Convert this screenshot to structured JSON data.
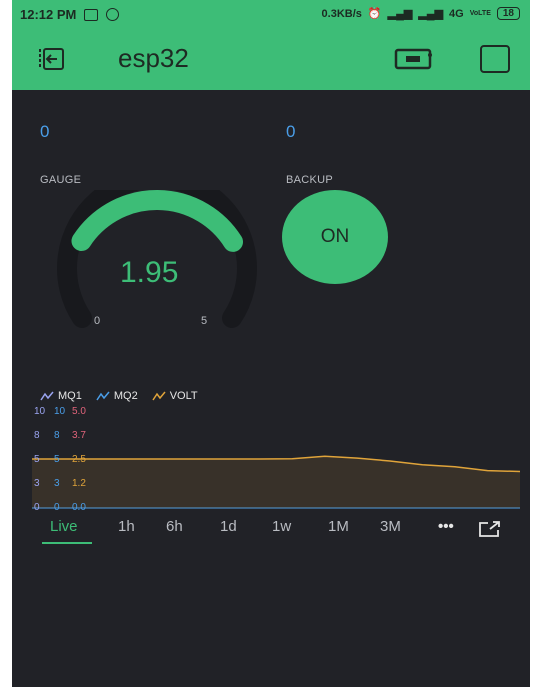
{
  "status_bar": {
    "time": "12:12 PM",
    "network_speed": "0.3KB/s",
    "network_type": "4G",
    "volte": "VoLTE",
    "battery": "18"
  },
  "app_bar": {
    "title": "esp32",
    "back_icon": "exit-icon",
    "device_icon": "device-icon",
    "menu_icon": "square-icon"
  },
  "widgets": {
    "left_value": "0",
    "right_value": "0",
    "gauge": {
      "label": "GAUGE",
      "value": "1.95",
      "min": "0",
      "max": "5",
      "fraction": 0.39
    },
    "backup": {
      "label": "BACKUP",
      "button_label": "ON"
    }
  },
  "chart_data": {
    "type": "line",
    "series": [
      {
        "name": "MQ1",
        "color": "#9aa4f0",
        "axis_ticks": [
          "0",
          "3",
          "5",
          "8",
          "10"
        ]
      },
      {
        "name": "MQ2",
        "color": "#4a9ee8",
        "axis_ticks": [
          "0",
          "3",
          "5",
          "8",
          "10"
        ]
      },
      {
        "name": "VOLT",
        "color": "#e0a43a",
        "axis_ticks": [
          "0.0",
          "1.2",
          "2.5",
          "3.7",
          "5.0"
        ],
        "values": [
          2.55,
          2.55,
          2.55,
          2.55,
          2.55,
          2.55,
          2.55,
          2.55,
          2.57,
          2.7,
          2.6,
          2.45,
          2.25,
          2.15,
          1.95,
          1.9
        ]
      }
    ],
    "ylim": [
      0,
      5
    ],
    "grid": false
  },
  "ranges": {
    "items": [
      "Live",
      "1h",
      "6h",
      "1d",
      "1w",
      "1M",
      "3M",
      "•••"
    ],
    "active": "Live"
  }
}
